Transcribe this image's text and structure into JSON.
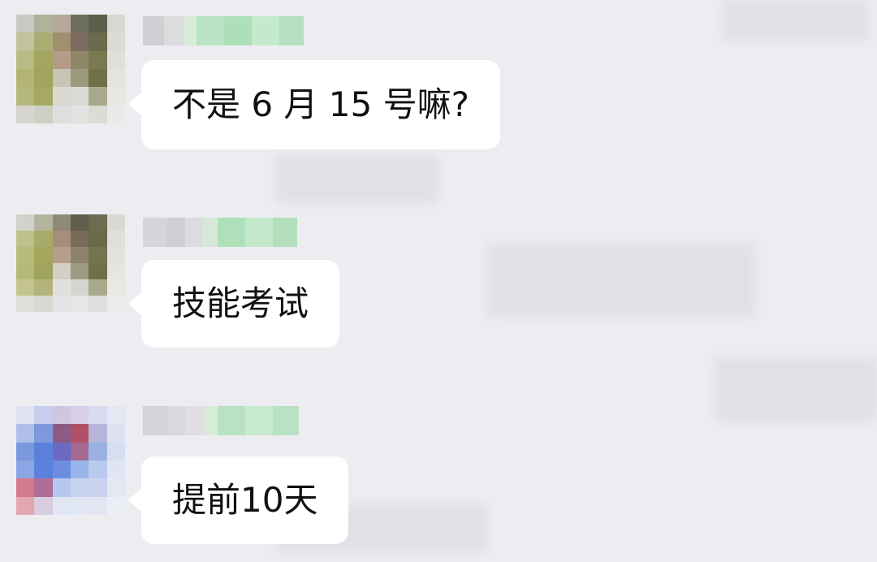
{
  "colors": {
    "background": "#ededf1",
    "bubble": "#ffffff",
    "text": "#111111"
  },
  "messages": [
    {
      "text": "不是 6 月 15 号嘛?",
      "avatar": "avatar-1"
    },
    {
      "text": "技能考试",
      "avatar": "avatar-2"
    },
    {
      "text": "提前10天",
      "avatar": "avatar-3"
    }
  ]
}
